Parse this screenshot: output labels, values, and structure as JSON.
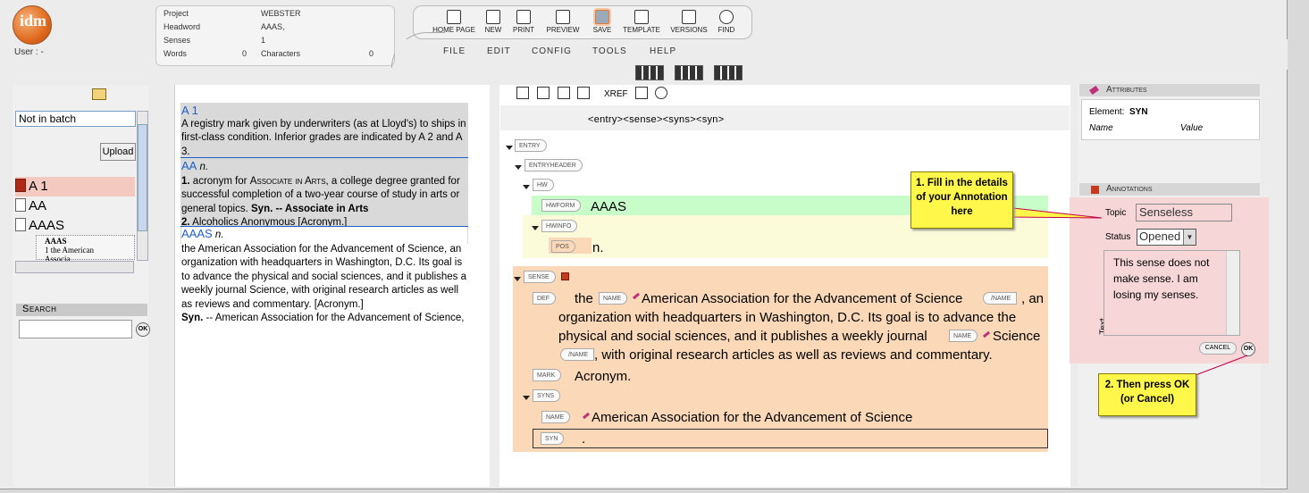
{
  "header": {
    "logo_text": "idm",
    "user_label": "User : -",
    "project_label": "Project",
    "project_value": "WEBSTER",
    "headword_label": "Headword",
    "headword_value": "AAAS,",
    "senses_label": "Senses",
    "senses_value": "1",
    "words_label": "Words",
    "words_value": "0",
    "characters_label": "Characters",
    "characters_value": "0"
  },
  "toolbar": [
    "HOME PAGE",
    "NEW",
    "PRINT",
    "PREVIEW",
    "SAVE",
    "TEMPLATE",
    "VERSIONS",
    "FIND"
  ],
  "menu": [
    "FILE",
    "EDIT",
    "CONFIG",
    "TOOLS",
    "HELP"
  ],
  "left": {
    "batch_value": "Not in batch",
    "upload_label": "Upload",
    "items": [
      "A 1",
      "AA",
      "AAAS"
    ],
    "sub_head": "AAAS",
    "sub_text": "1 the American Associa...",
    "search_label": "Search",
    "ok": "OK"
  },
  "dict": {
    "a1_hw": "A 1",
    "a1_def": "A registry mark given by underwriters (as at Lloyd's) to ships in first-class condition. Inferior grades are indicated by A 2 and A 3.",
    "aa_hw": "AA",
    "aa_pos": "n.",
    "aa_1_num": "1.",
    "aa_1_a": "acronym for",
    "aa_1_sc": "Associate in Arts",
    "aa_1_b": ", a college degree granted for successful completion of a two-year course of study in arts or general topics.",
    "aa_1_syn": "Syn. -- Associate in Arts",
    "aa_2_num": "2.",
    "aa_2_def": "Alcoholics Anonymous [Acronym.]",
    "aaas_hw": "AAAS",
    "aaas_pos": "n.",
    "aaas_def": "the American Association for the Advancement of Science, an organization with headquarters in Washington, D.C. Its goal is to advance the physical and social sciences, and it publishes a weekly journal Science, with original research articles as well as reviews and commentary. [Acronym.]",
    "aaas_syn_label": "Syn.",
    "aaas_syn": "-- American Association for the Advancement of Science,"
  },
  "xml": {
    "xref": "XREF",
    "path": "<entry><sense><syns><syn>",
    "tags": {
      "entry": "ENTRY",
      "entryheader": "ENTRYHEADER",
      "hw": "HW",
      "hwform": "HWFORM",
      "hwinfo": "HWINFO",
      "pos": "POS",
      "sense": "SENSE",
      "def": "DEF",
      "name": "NAME",
      "name_end": "/NAME",
      "mark": "MARK",
      "syns": "SYNS",
      "syn": "SYN"
    },
    "hwform_text": "AAAS",
    "pos_text": "n.",
    "def_the": "the",
    "def_name": "American Association for the Advancement of Science",
    "def_after": ", an",
    "def_line2": "organization with headquarters in Washington, D.C. Its goal is to advance the",
    "def_line3a": "physical and social sciences, and it publishes a weekly journal",
    "def_science": "Science",
    "def_line4": ", with original research articles as well as reviews and commentary.",
    "mark_text": "Acronym.",
    "syns_name": "American Association for the Advancement of Science",
    "syn_text": "."
  },
  "right": {
    "attributes_title": "Attributes",
    "element_label": "Element:",
    "element_value": "SYN",
    "name_col": "Name",
    "value_col": "Value",
    "annotations_title": "Annotations",
    "topic_label": "Topic",
    "topic_value": "Senseless",
    "status_label": "Status",
    "status_value": "Opened",
    "text_label": "Text",
    "text_value": "This sense does not make sense. I am losing my senses.",
    "cancel_label": "CANCEL",
    "ok_label": "OK"
  },
  "callouts": {
    "one": "1. Fill in the details of your Annotation here",
    "two": "2. Then press OK (or Cancel)"
  },
  "colors": {
    "accent": "#1f5fc9",
    "hwform_bg": "#c8fcc8",
    "hwinfo_bg": "#fbfbd9",
    "sense_bg": "#fbd9b8",
    "annot_bg": "#f6d6d6",
    "callout": "#fff84a"
  }
}
